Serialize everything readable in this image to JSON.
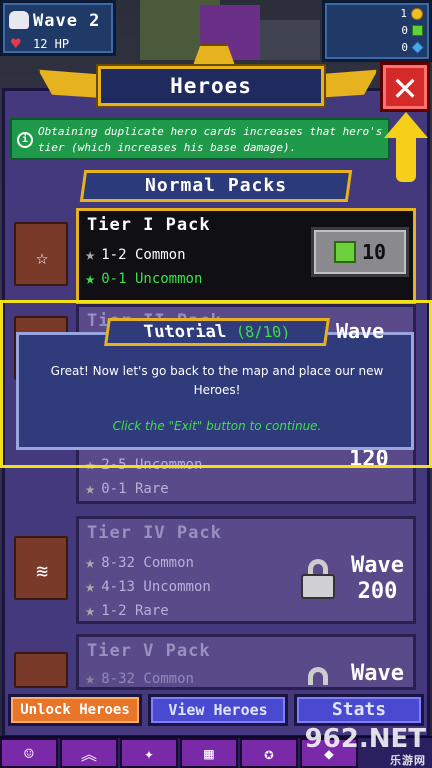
{
  "hud": {
    "wave": "Wave 2",
    "hp": "12 HP",
    "coins": "1",
    "green_gems": "0",
    "blue_gems": "0"
  },
  "title": "Heroes",
  "info_text": "Obtaining duplicate hero cards increases that hero's tier (which increases his base damage).",
  "section": "Normal Packs",
  "packs": [
    {
      "name": "Tier I Pack",
      "lines": [
        "1-2 Common",
        "0-1 Uncommon"
      ],
      "cost": "10"
    },
    {
      "name": "Tier II Pack",
      "lines": [
        "2-5 Uncommon",
        "0-1 Rare"
      ],
      "wave_label": "Wave",
      "wave_value": "120"
    },
    {
      "name": "Tier IV Pack",
      "lines": [
        "8-32 Common",
        "4-13 Uncommon",
        "1-2 Rare"
      ],
      "wave_label": "Wave",
      "wave_value": "200"
    },
    {
      "name": "Tier V Pack",
      "lines": [
        "8-32 Common"
      ],
      "wave_label": "Wave"
    }
  ],
  "tutorial": {
    "title": "Tutorial",
    "progress": "(8/10)",
    "message": "Great! Now let's go back to the map and place our new Heroes!",
    "hint": "Click the \"Exit\" button to continue.",
    "wave_label": "Wave"
  },
  "buttons": {
    "unlock": "Unlock Heroes",
    "view": "View Heroes",
    "stats": "Stats"
  },
  "watermark": {
    "main": "962.NET",
    "sub": "乐游网"
  },
  "colors": {
    "accent_gold": "#e6b21d",
    "close_red": "#d52a2a",
    "info_green": "#1e9a4a",
    "highlight_yellow": "#f4e01a"
  }
}
